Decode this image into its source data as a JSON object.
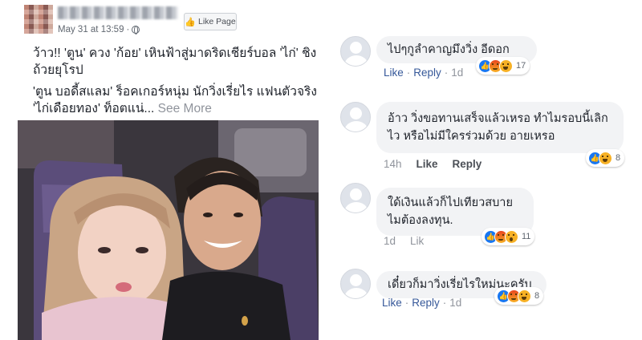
{
  "post": {
    "author_name": "",
    "date": "May 31 at 13:59",
    "date_separator": "·",
    "like_page_label": "Like Page",
    "text_line1": "ว้าว!! 'ตูน' ควง 'ก้อย' เหินฟ้าสู่มาดริดเชียร์บอล 'ไก่' ชิงถ้วยยุโรป",
    "text_line2": "'ตูน บอดี้สแลม' ร็อคเกอร์หนุ่ม นักวิ่งเรี่ยไร แฟนตัวจริง 'ไก่เดือยทอง' ท็อตแน่...",
    "see_more": "See More"
  },
  "comments": [
    {
      "text": "ไปๆกูลำคาญมึงวิ่ง อีดอก",
      "actions": [
        "Like",
        "Reply"
      ],
      "time": "1d",
      "reactions": [
        "like",
        "angry",
        "haha"
      ],
      "reaction_count": "17"
    },
    {
      "text": "อ้าว วิ่งขอทานเสร็จแล้วเหรอ ทำไมรอบนี้เลิกไว หรือไม่มีใครร่วมด้วย อายเหรอ",
      "time_first": "14h",
      "actions": [
        "Like",
        "Reply"
      ],
      "reactions": [
        "like",
        "haha"
      ],
      "reaction_count": "8"
    },
    {
      "text": "ใด้เงินแล้วก็ไปเทียวสบายไมต้องลงทุน.",
      "time_first": "1d",
      "actions": [
        "Lik"
      ],
      "reactions": [
        "like",
        "angry",
        "wow"
      ],
      "reaction_count": "11"
    },
    {
      "text": "เดี๋ยวก็มาวิ่งเรี่ยไรใหม่นะครับ",
      "actions": [
        "Like",
        "Reply"
      ],
      "time": "1d",
      "reactions": [
        "like",
        "angry",
        "haha"
      ],
      "reaction_count": "8"
    }
  ],
  "colors": {
    "link_blue": "#365899",
    "bubble_gray": "#f2f3f5",
    "meta_gray": "#90949c",
    "like_blue": "#1877f2"
  }
}
